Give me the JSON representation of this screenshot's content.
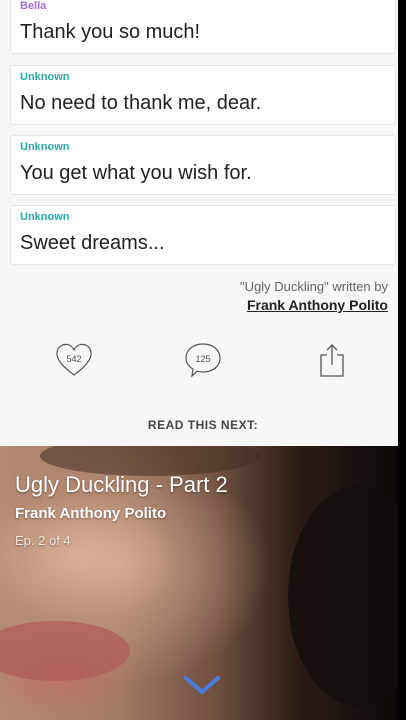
{
  "messages": [
    {
      "sender": "Bella",
      "text": "Thank you so much!",
      "color": "#a86fd0"
    },
    {
      "sender": "Unknown",
      "text": "No need to thank me, dear.",
      "color": "#2aa8a8"
    },
    {
      "sender": "Unknown",
      "text": "You get what you wish for.",
      "color": "#2aa8a8"
    },
    {
      "sender": "Unknown",
      "text": "Sweet dreams...",
      "color": "#2aa8a8"
    }
  ],
  "credit": {
    "written_by": "\"Ugly Duckling\" written by",
    "author": "Frank Anthony Polito"
  },
  "actions": {
    "likes": "542",
    "comments": "125",
    "share_icon": "share-icon"
  },
  "read_next_label": "READ THIS NEXT:",
  "next_story": {
    "title": "Ugly Duckling - Part 2",
    "author": "Frank Anthony Polito",
    "episode": "Ep. 2 of 4"
  },
  "colors": {
    "accent": "#4a7be0"
  }
}
